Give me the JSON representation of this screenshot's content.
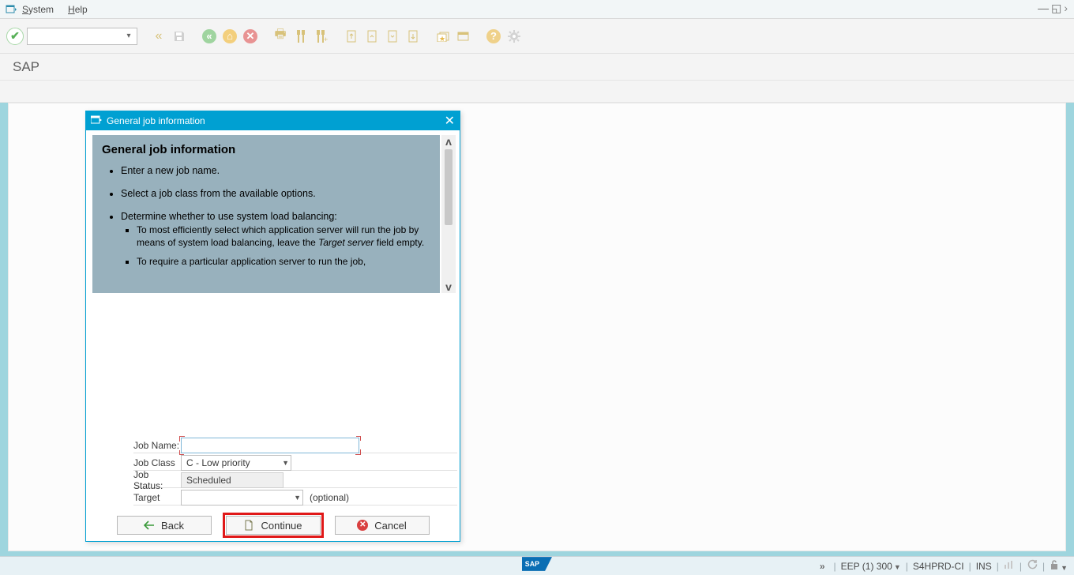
{
  "menu": {
    "system": "System",
    "help": "Help"
  },
  "page_title": "SAP",
  "dialog": {
    "title": "General job information",
    "heading": "General job information",
    "bullets": {
      "b1": "Enter a new job name.",
      "b2": "Select a job class from the available options.",
      "b3": "Determine whether to use system load balancing:",
      "s1a": "To most efficiently select which application server will run the job by means of system load balancing, leave the ",
      "s1b": "Target server",
      "s1c": " field empty.",
      "s2": "To require a particular application server to run the job,"
    },
    "form": {
      "job_name_label": "Job Name:",
      "job_name_value": "",
      "job_class_label": "Job Class",
      "job_class_value": "C - Low priority",
      "job_status_label": "Job Status:",
      "job_status_value": "Scheduled",
      "target_label": "Target",
      "target_value": "",
      "target_hint": "(optional)"
    },
    "buttons": {
      "back": "Back",
      "continue": "Continue",
      "cancel": "Cancel"
    }
  },
  "status": {
    "system": "EEP (1) 300",
    "server": "S4HPRD-CI",
    "mode": "INS"
  }
}
